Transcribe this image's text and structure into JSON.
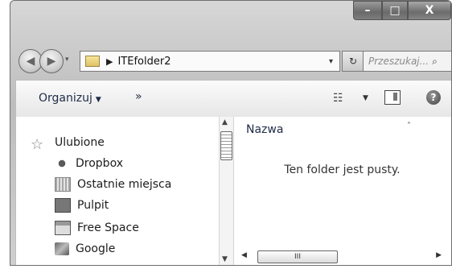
{
  "window": {
    "caption": {
      "min_glyph": "–",
      "max_glyph": "□",
      "close_glyph": "X"
    }
  },
  "nav": {
    "back_glyph": "◀",
    "forward_glyph": "▶",
    "history_glyph": "▾",
    "address": {
      "separator": "▶",
      "path": "ITEfolder2",
      "dropdown_glyph": "▾"
    },
    "refresh_glyph": "↻",
    "search": {
      "placeholder": "Przeszukaj...",
      "icon_glyph": "⌕"
    }
  },
  "toolbar": {
    "organize_label": "Organizuj",
    "organize_arrow": "▼",
    "more_label": "»",
    "view_glyph": "☷",
    "view_drop_glyph": "▼",
    "help_glyph": "?"
  },
  "sidebar": {
    "favorites_label": "Ulubione",
    "favorites_glyph": "☆",
    "items": [
      {
        "label": "Dropbox",
        "icon": "dropbox-icon"
      },
      {
        "label": "Ostatnie miejsca",
        "icon": "recent-places-icon"
      },
      {
        "label": "Pulpit",
        "icon": "desktop-icon"
      },
      {
        "label": "Free Space",
        "icon": "drive-icon"
      },
      {
        "label": "Google",
        "icon": "google-icon"
      }
    ]
  },
  "scroll": {
    "up": "▲",
    "down": "▼",
    "left": "◀",
    "right": "▶",
    "grip": "III"
  },
  "files": {
    "column_name": "Nazwa",
    "sort_glyph": "˄",
    "empty_message": "Ten folder jest pusty."
  }
}
